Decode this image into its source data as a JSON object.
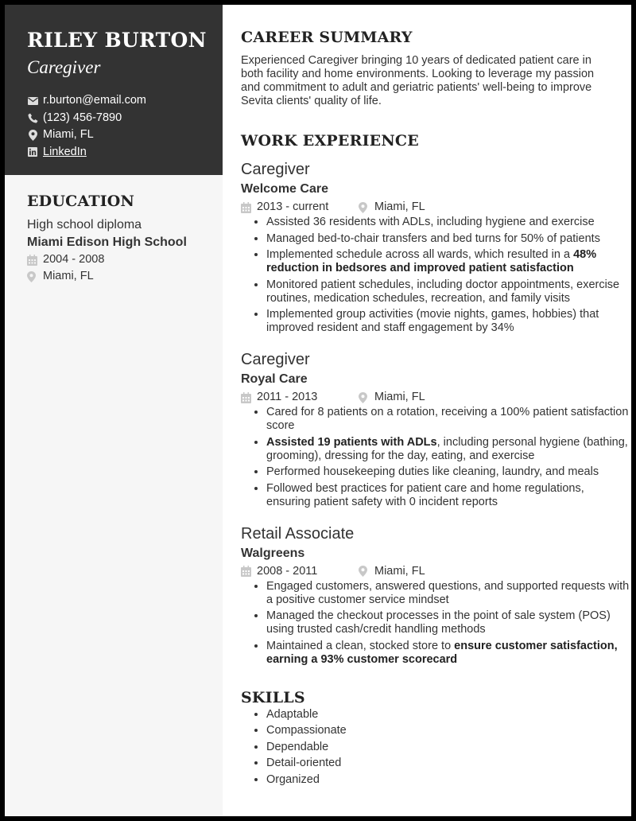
{
  "header": {
    "name": "RILEY BURTON",
    "title": "Caregiver"
  },
  "contact": {
    "email": "r.burton@email.com",
    "phone": "(123) 456-7890",
    "location": "Miami, FL",
    "linkedin": "LinkedIn"
  },
  "education": {
    "heading": "EDUCATION",
    "degree": "High school diploma",
    "school": "Miami Edison High School",
    "dates": "2004 - 2008",
    "location": "Miami, FL"
  },
  "summary": {
    "heading": "CAREER SUMMARY",
    "text": "Experienced Caregiver bringing 10 years of dedicated patient care in both facility and home environments. Looking to leverage my passion and commitment to adult and geriatric patients' well-being to improve Sevita clients' quality of life."
  },
  "experience": {
    "heading": "WORK EXPERIENCE",
    "jobs": [
      {
        "title": "Caregiver",
        "company": "Welcome Care",
        "dates": "2013 - current",
        "location": "Miami, FL",
        "bullets": [
          {
            "pre": "Assisted 36 residents with ADLs, including hygiene and exercise",
            "bold": "",
            "post": ""
          },
          {
            "pre": "Managed bed-to-chair transfers and bed turns for 50% of patients",
            "bold": "",
            "post": ""
          },
          {
            "pre": "Implemented schedule across all wards, which resulted in a ",
            "bold": "48% reduction in bedsores and improved patient satisfaction",
            "post": ""
          },
          {
            "pre": "Monitored patient schedules, including doctor appointments, exercise routines, medication schedules, recreation, and family visits",
            "bold": "",
            "post": ""
          },
          {
            "pre": "Implemented group activities (movie nights, games, hobbies) that improved resident and staff engagement by 34%",
            "bold": "",
            "post": ""
          }
        ]
      },
      {
        "title": "Caregiver",
        "company": "Royal Care",
        "dates": "2011 - 2013",
        "location": "Miami, FL",
        "bullets": [
          {
            "pre": "Cared for 8 patients on a rotation, receiving a 100% patient satisfaction score",
            "bold": "",
            "post": ""
          },
          {
            "pre": "",
            "bold": "Assisted 19 patients with ADLs",
            "post": ", including personal hygiene (bathing, grooming), dressing for the day, eating, and exercise"
          },
          {
            "pre": "Performed housekeeping duties like cleaning, laundry, and meals",
            "bold": "",
            "post": ""
          },
          {
            "pre": "Followed best practices for patient care and home regulations, ensuring patient safety with 0 incident reports",
            "bold": "",
            "post": ""
          }
        ]
      },
      {
        "title": "Retail Associate",
        "company": "Walgreens",
        "dates": "2008 - 2011",
        "location": "Miami, FL",
        "bullets": [
          {
            "pre": "Engaged customers, answered questions, and supported requests with a positive customer service mindset",
            "bold": "",
            "post": ""
          },
          {
            "pre": "Managed the checkout processes in the point of sale system (POS) using trusted cash/credit handling methods",
            "bold": "",
            "post": ""
          },
          {
            "pre": "Maintained a clean, stocked store to ",
            "bold": "ensure customer satisfaction, earning a 93% customer scorecard",
            "post": ""
          }
        ]
      }
    ]
  },
  "skills": {
    "heading": "SKILLS",
    "items": [
      "Adaptable",
      "Compassionate",
      "Dependable",
      "Detail-oriented",
      "Organized"
    ]
  },
  "colors": {
    "sidebar_header": "#333333",
    "sidebar_body": "#f6f6f6",
    "icon_gray": "#bbbbbb"
  }
}
